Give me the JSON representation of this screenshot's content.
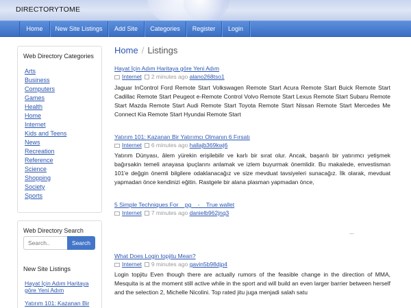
{
  "brand": "DIRECTORYTOME",
  "nav": [
    "Home",
    "New Site Listings",
    "Add Site",
    "Categories",
    "Register",
    "Login"
  ],
  "categories": {
    "title": "Web Directory Categories",
    "items": [
      "Arts",
      "Business",
      "Computers",
      "Games",
      "Health",
      "Home",
      "Internet",
      "Kids and Teens",
      "News",
      "Recreation",
      "Reference",
      "Science",
      "Shopping",
      "Society",
      "Sports"
    ]
  },
  "search": {
    "title": "Web Directory Search",
    "placeholder": "Search..",
    "button": "Search"
  },
  "new_listings": {
    "title": "New Site Listings",
    "items": [
      "Hayat İçin Adım Haritaya göre Yeni Adım",
      "Yatırım 101: Kazanan Bir"
    ]
  },
  "breadcrumb": {
    "home": "Home",
    "current": "Listings"
  },
  "posts": [
    {
      "title": "Hayat İçin Adım Haritaya göre Yeni Adım",
      "category": "Internet",
      "time": "2 minutes ago",
      "author": "alano268tso1",
      "excerpt": "Jaguar InControl Ford Remote Start Volkswagen Remote Start Acura Remote Start Buick Remote Start Cadillac Remote Start Peugeot e-Remote Control Volvo Remote Start Lexus Remote Start Subaru Remote Start Mazda Remote Start Audi Remote Start Toyota Remote Start Nissan Remote Start Mercedes Me Connect Kia Remote Start Hyundai Remote Start"
    },
    {
      "title": "Yatırım 101: Kazanan Bir Yatırımcı Olmanın 6 Fırsatı",
      "category": "Internet",
      "time": "6 minutes ago",
      "author": "hallajb369kwj6",
      "excerpt": "Yatırım Dünyası, âlem yürekin erişilebilir ve karlı bir sırat olur. Ancak, başarılı bir yatırımcı yetişmek bağırsakin temeli anayasa ipuçlarını anlamak ve izlem buyurmak önemlidir. Bu makalede, envestisman 101'e değgin önemli bilgilere odaklanacağız ve size mevduat tavsiyeleri sunacağız. İlk olarak, mevduat yapmadan önce kendinizi eğitin. Rastgele bir alana plasman yapmadan önce,"
    },
    {
      "title": "5 Simple Techniques For    pg    -    True wallet",
      "category": "Internet",
      "time": "7 minutes ago",
      "author": "danielb962jnq3",
      "excerpt": ""
    },
    {
      "title": "What Does Login topjitu Mean?",
      "category": "Internet",
      "time": "9 minutes ago",
      "author": "gavin5b98djp4",
      "excerpt": "Login topjitu Even though there are actually rumors of the feasible change in the direction of MMA, Mesquita is at the moment still active while in the sport and will build an even larger barrier between herself and the selection 2, Michelle Nicolini. Top rated jitu juga menjadi salah satu"
    }
  ],
  "ellipsis": "..."
}
